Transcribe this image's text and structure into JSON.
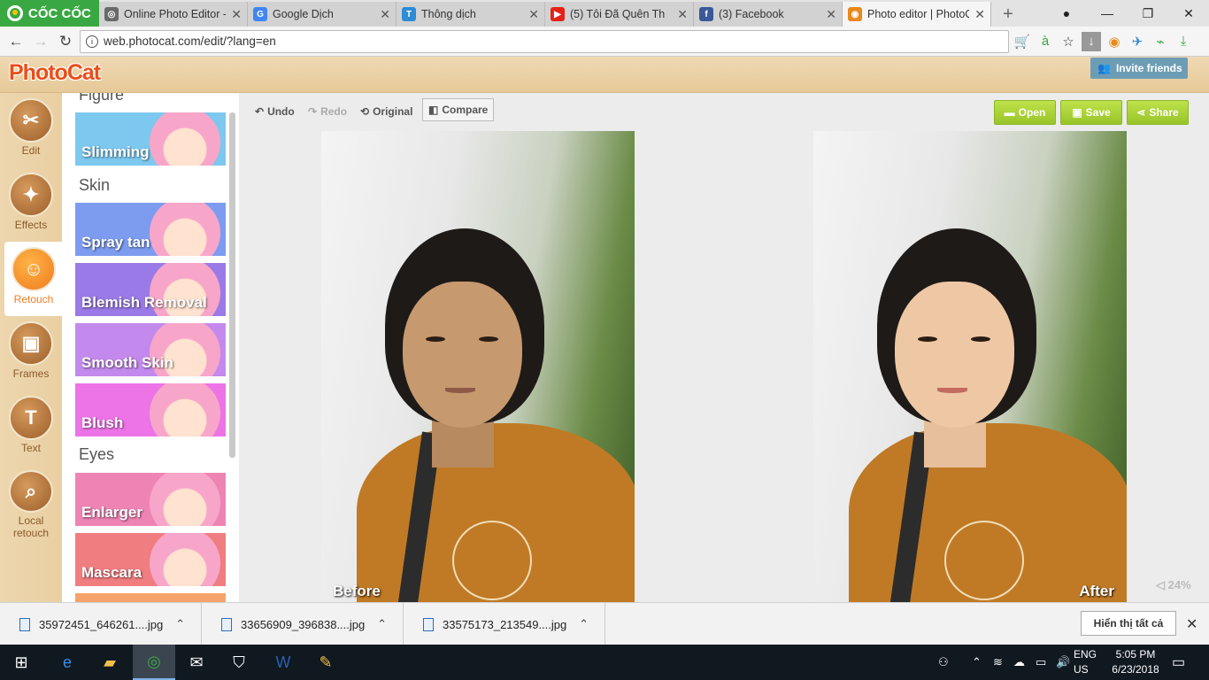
{
  "browser": {
    "name": "CỐC CỐC",
    "tabs": [
      {
        "title": "Online Photo Editor -",
        "icon": "globe-icon",
        "color": "#6a6a6a",
        "glyph": "◎"
      },
      {
        "title": "Google Dịch",
        "icon": "google-translate-icon",
        "color": "#4285f4",
        "glyph": "G"
      },
      {
        "title": "Thông dịch",
        "icon": "translate-icon",
        "color": "#2e8bd6",
        "glyph": "T"
      },
      {
        "title": "(5) Tôi Đã Quên Th",
        "icon": "youtube-icon",
        "color": "#e62117",
        "glyph": "▶"
      },
      {
        "title": "(3) Facebook",
        "icon": "facebook-icon",
        "color": "#3b5998",
        "glyph": "f"
      },
      {
        "title": "Photo editor | PhotoC",
        "icon": "photocat-icon",
        "color": "#e8891a",
        "glyph": "◉"
      }
    ],
    "url": "web.photocat.com/edit/?lang=en"
  },
  "app": {
    "logo": "PhotoCat",
    "invite_label": "Invite friends",
    "rail": [
      {
        "label": "Edit",
        "glyph": "✂"
      },
      {
        "label": "Effects",
        "glyph": "✦"
      },
      {
        "label": "Retouch",
        "glyph": "☺"
      },
      {
        "label": "Frames",
        "glyph": "▣"
      },
      {
        "label": "Text",
        "glyph": "T"
      },
      {
        "label": "Local retouch",
        "glyph": "⌕"
      }
    ],
    "panel": {
      "sections": [
        "Figure",
        "Skin",
        "Eyes"
      ],
      "tools": [
        {
          "label": "Slimming",
          "color": "#7dc8ef"
        },
        {
          "label": "Spray tan",
          "color": "#7d9cf0"
        },
        {
          "label": "Blemish Removal",
          "color": "#9a7ae6"
        },
        {
          "label": "Smooth Skin",
          "color": "#c389ec"
        },
        {
          "label": "Blush",
          "color": "#ec74e6"
        },
        {
          "label": "Enlarger",
          "color": "#ee84b4"
        },
        {
          "label": "Mascara",
          "color": "#f07d80"
        }
      ]
    },
    "toolbar": {
      "undo": "Undo",
      "redo": "Redo",
      "original": "Original",
      "compare": "Compare",
      "open": "Open",
      "save": "Save",
      "share": "Share"
    },
    "before_label": "Before",
    "after_label": "After",
    "zoom": "24%"
  },
  "downloads": {
    "files": [
      "35972451_646261....jpg",
      "33656909_396838....jpg",
      "33575173_213549....jpg"
    ],
    "show_all": "Hiển thị tất cả"
  },
  "taskbar": {
    "lang_top": "ENG",
    "lang_bottom": "US",
    "time": "5:05 PM",
    "date": "6/23/2018"
  }
}
